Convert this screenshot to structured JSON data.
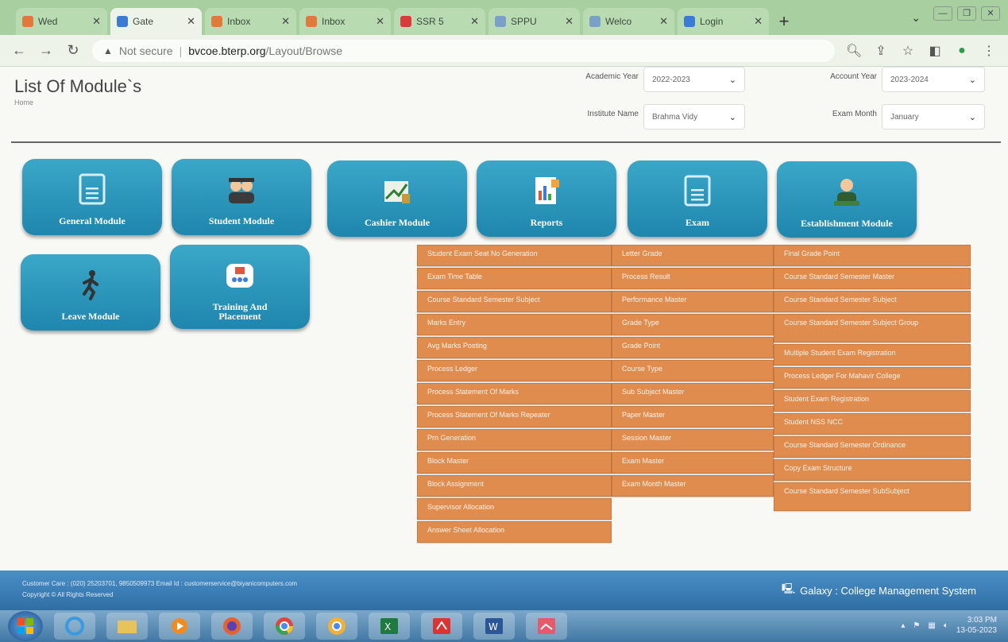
{
  "browser": {
    "tabs": [
      {
        "label": "Wed",
        "color": "#e07a3a"
      },
      {
        "label": "Gate",
        "color": "#3a7bd5",
        "active": true
      },
      {
        "label": "Inbox",
        "color": "#e07a3a"
      },
      {
        "label": "Inbox",
        "color": "#e07a3a"
      },
      {
        "label": "SSR 5",
        "color": "#d83b3b"
      },
      {
        "label": "SPPU",
        "color": "#7aa0c8"
      },
      {
        "label": "Welco",
        "color": "#7aa0c8"
      },
      {
        "label": "Login",
        "color": "#3a7bd5"
      }
    ],
    "new_tab": "+",
    "address": {
      "security": "Not secure",
      "host": "bvcoe.bterp.org",
      "path": "/Layout/Browse"
    }
  },
  "header": {
    "title": "List Of Module`s",
    "breadcrumb": "Home",
    "filters": {
      "academic_year_label": "Academic Year",
      "academic_year": "2022-2023",
      "account_year_label": "Account Year",
      "account_year": "2023-2024",
      "institute_label": "Institute Name",
      "institute": "Brahma Vidy",
      "exam_month_label": "Exam Month",
      "exam_month": "January"
    }
  },
  "modules": [
    {
      "label": "General Module",
      "icon": "document-icon"
    },
    {
      "label": "Student Module",
      "icon": "students-icon"
    },
    {
      "label": "Cashier Module",
      "icon": "cashier-icon"
    },
    {
      "label": "Reports",
      "icon": "report-icon"
    },
    {
      "label": "Exam",
      "icon": "document-icon"
    },
    {
      "label": "Establishment Module",
      "icon": "person-icon"
    },
    {
      "label": "Leave Module",
      "icon": "walker-icon"
    },
    {
      "label": "Training And Placement",
      "icon": "training-icon"
    }
  ],
  "exam_menu": {
    "col1": [
      "Student Exam Seat No Generation",
      "Exam Time Table",
      "Course Standard Semester Subject",
      "Marks Entry",
      "Avg Marks Posting",
      "Process Ledger",
      "Process Statement Of Marks",
      "Process Statement Of Marks Repeater",
      "Prn Generation",
      "Block Master",
      "Block Assignment",
      "Supervisor Allocation",
      "Answer Sheet Allocation"
    ],
    "col2": [
      "Letter Grade",
      "Process Result",
      "Performance Master",
      "Grade Type",
      "Grade Point",
      "Course Type",
      "Sub Subject Master",
      "Paper Master",
      "Session Master",
      "Exam Master",
      "Exam Month Master"
    ],
    "col3": [
      "Final Grade Point",
      "Course Standard Semester Master",
      "Course Standard Semester Subject",
      "Course Standard Semester Subject Group",
      "Multiple Student Exam Registration",
      "Process Ledger For Mahavir College",
      "Student Exam Registration",
      "Student NSS NCC",
      "Course Standard Semester Ordinance",
      "Copy Exam Structure",
      "Course Standard Semester SubSubject"
    ]
  },
  "footer": {
    "care": "Customer Care : (020) 25203701, 9850509973    Email Id : customerservice@biyanicomputers.com",
    "copyright": "Copyright © All Rights Reserved",
    "brand": "Galaxy : College Management System"
  },
  "taskbar": {
    "time": "3:03 PM",
    "date": "13-05-2023"
  }
}
